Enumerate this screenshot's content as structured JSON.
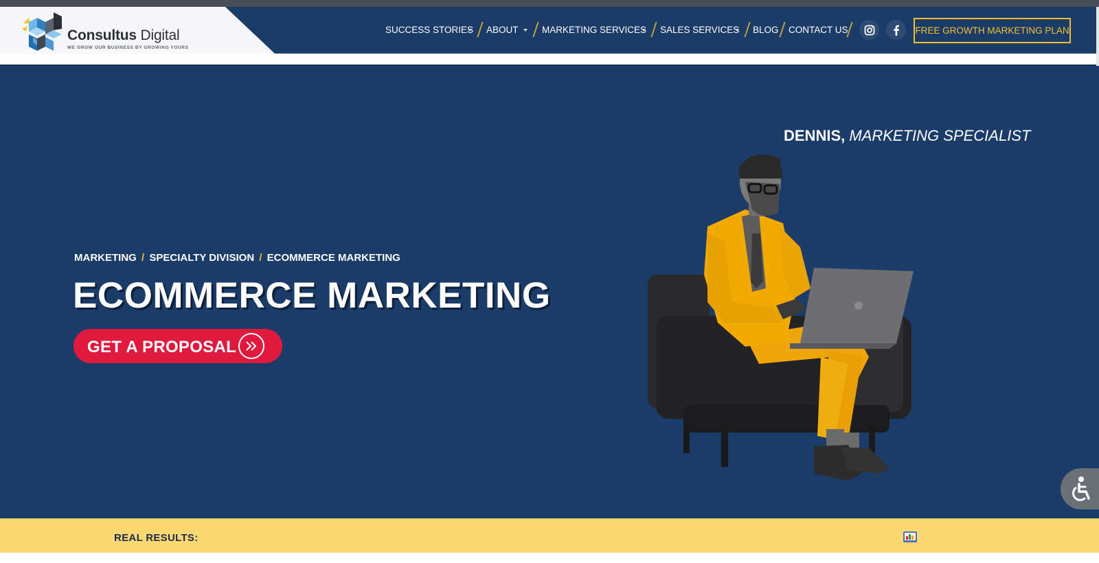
{
  "brand": {
    "name_bold": "Consultus",
    "name_regular": " Digital",
    "tagline": "WE GROW OUR BUSINESS BY GROWING YOURS"
  },
  "nav": {
    "items": [
      {
        "label": "SUCCESS STORIES",
        "has_dropdown": true
      },
      {
        "label": "ABOUT",
        "has_dropdown": true
      },
      {
        "label": "MARKETING SERVICES",
        "has_dropdown": true
      },
      {
        "label": "SALES SERVICES",
        "has_dropdown": true
      },
      {
        "label": "BLOG",
        "has_dropdown": false
      },
      {
        "label": "CONTACT US",
        "has_dropdown": false
      }
    ],
    "social": [
      "instagram-icon",
      "facebook-icon"
    ],
    "cta_label": "FREE GROWTH MARKETING PLAN"
  },
  "hero": {
    "person_name": "DENNIS,",
    "person_role": " MARKETING SPECIALIST",
    "breadcrumb": [
      "MARKETING",
      "SPECIALTY DIVISION",
      "ECOMMERCE MARKETING"
    ],
    "breadcrumb_separator": "/",
    "title": "ECOMMERCE MARKETING",
    "button_label": "GET A PROPOSAL",
    "button_icon": "double-chevron-right-icon"
  },
  "results": {
    "label": "REAL RESULTS:"
  },
  "accessibility": {
    "icon": "accessibility-icon"
  },
  "colors": {
    "navy": "#1b3c69",
    "gold": "#f4c231",
    "red": "#e0193f",
    "results_bg": "#fbd872",
    "suit": "#f2a900"
  }
}
